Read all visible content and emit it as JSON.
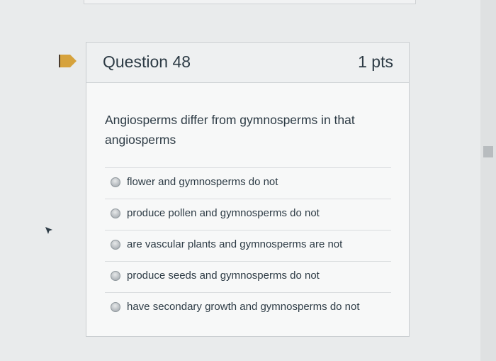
{
  "question": {
    "title": "Question 48",
    "points": "1 pts",
    "text": "Angiosperms differ from gymnosperms in that angiosperms"
  },
  "answers": [
    {
      "label": "flower and gymnosperms do not"
    },
    {
      "label": "produce pollen and gymnosperms do not"
    },
    {
      "label": "are vascular plants and gymnosperms are not"
    },
    {
      "label": "produce seeds and gymnosperms do not"
    },
    {
      "label": "have secondary growth and gymnosperms do not"
    }
  ],
  "icons": {
    "flag": "flag-icon",
    "cursor": "cursor-icon"
  },
  "colors": {
    "flag": "#d6a23c",
    "text": "#2d3b45"
  }
}
